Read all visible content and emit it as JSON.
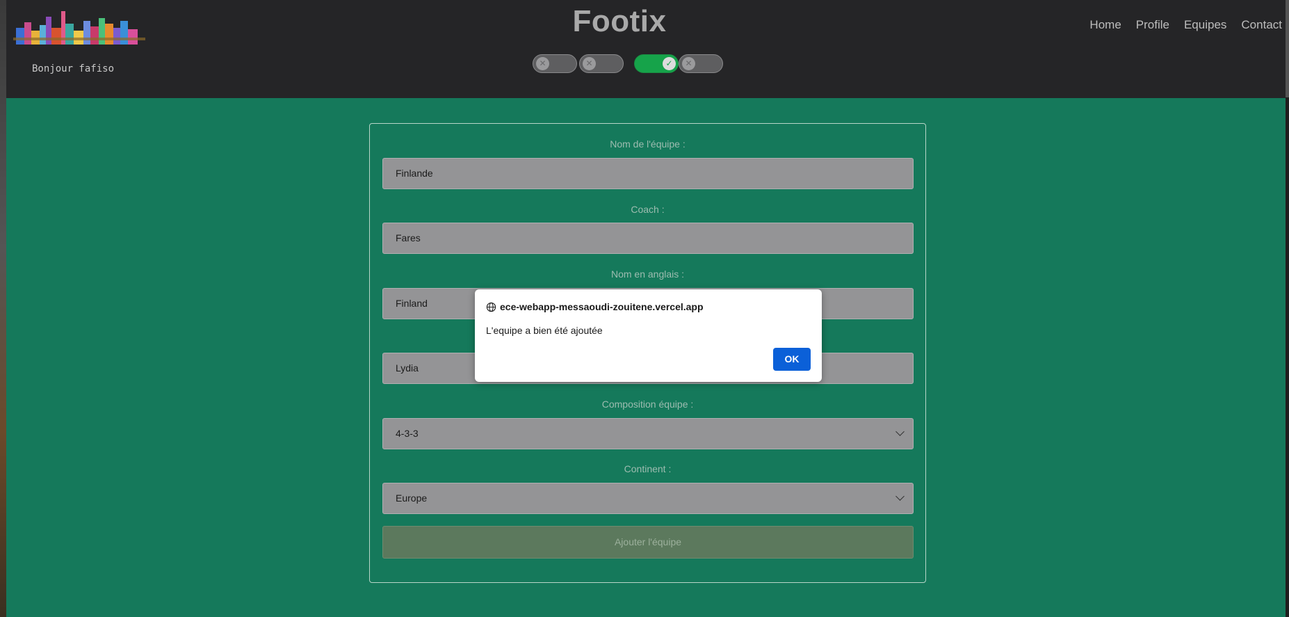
{
  "header": {
    "brand": "Footix",
    "greeting": "Bonjour fafiso",
    "nav": [
      "Home",
      "Profile",
      "Equipes",
      "Contact"
    ],
    "toggles": [
      {
        "state": "off",
        "icon": "x-icon"
      },
      {
        "state": "off",
        "icon": "x-icon"
      },
      {
        "state": "on",
        "icon": "check-icon"
      },
      {
        "state": "off",
        "icon": "x-icon"
      }
    ]
  },
  "form": {
    "team_name": {
      "label": "Nom de l'équipe :",
      "value": "Finlande"
    },
    "coach": {
      "label": "Coach :",
      "value": "Fares"
    },
    "english_name": {
      "label": "Nom en anglais :",
      "value": "Finland"
    },
    "fourth_field": {
      "value": "Lydia"
    },
    "composition": {
      "label": "Composition équipe :",
      "value": "4-3-3"
    },
    "continent": {
      "label": "Continent :",
      "value": "Europe"
    },
    "submit_label": "Ajouter l'équipe"
  },
  "dialog": {
    "origin": "ece-webapp-messaoudi-zouitene.vercel.app",
    "message": "L'equipe a bien été ajoutée",
    "ok_label": "OK"
  },
  "colors": {
    "page_bg": "#15795b",
    "header_bg": "#252527",
    "toggle_on": "#16a34a",
    "dialog_button": "#0b60d8"
  }
}
